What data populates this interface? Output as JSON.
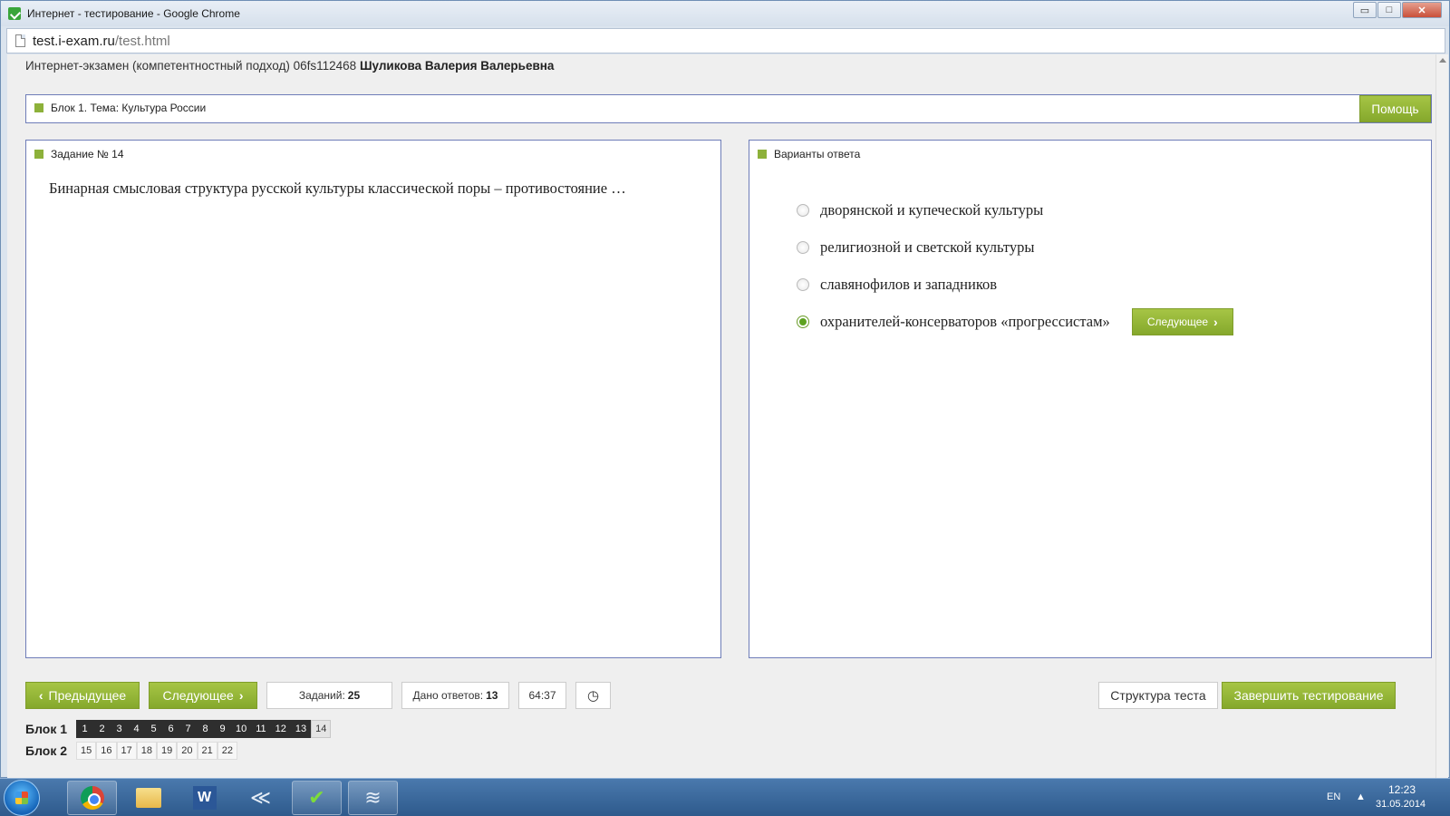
{
  "window": {
    "title": "Интернет - тестирование - Google Chrome",
    "controls": {
      "minimize": "▭",
      "maximize": "□",
      "close": "✕"
    }
  },
  "address": {
    "host": "test.i-exam.ru",
    "path": "/test.html"
  },
  "exam": {
    "prefix": "Интернет-экзамен (компетентностный подход) 06fs112468",
    "student": "Шуликова Валерия Валерьевна"
  },
  "topic": {
    "label": "Блок 1. Тема: Культура России",
    "help_label": "Помощь"
  },
  "question": {
    "header": "Задание № 14",
    "text": "Бинарная смысловая структура русской культуры классической поры – противостояние …"
  },
  "answers": {
    "header": "Варианты ответа",
    "options": [
      {
        "label": "дворянской и купеческой культуры",
        "selected": false
      },
      {
        "label": "религиозной и светской культуры",
        "selected": false
      },
      {
        "label": "славянофилов и западников",
        "selected": false
      },
      {
        "label": "охранителей-консерваторов «прогрессистам»",
        "selected": true
      }
    ],
    "next_label": "Следующее"
  },
  "footer": {
    "prev_label": "Предыдущее",
    "next_label": "Следующее",
    "tasks_label": "Заданий:",
    "tasks_value": "25",
    "answers_label": "Дано ответов:",
    "answers_value": "13",
    "timer": "64:37",
    "structure_label": "Структура теста",
    "finish_label": "Завершить тестирование"
  },
  "blocks": [
    {
      "label": "Блок 1",
      "items": [
        "1",
        "2",
        "3",
        "4",
        "5",
        "6",
        "7",
        "8",
        "9",
        "10",
        "11",
        "12",
        "13",
        "14"
      ],
      "answered": 13,
      "current": "14"
    },
    {
      "label": "Блок 2",
      "items": [
        "15",
        "16",
        "17",
        "18",
        "19",
        "20",
        "21",
        "22"
      ],
      "answered": 0,
      "current": ""
    }
  ],
  "icons": {
    "app": "i-exam-icon",
    "page": "page-icon",
    "chevron_left": "‹",
    "chevron_right": "›",
    "clock": "◷"
  },
  "colors": {
    "accent_green": "#8db13a",
    "panel_border": "#6e7db8",
    "answered_cell": "#2e2e2e"
  },
  "taskbar": {
    "lang": "EN",
    "time": "12:23",
    "date": "31.05.2014"
  }
}
